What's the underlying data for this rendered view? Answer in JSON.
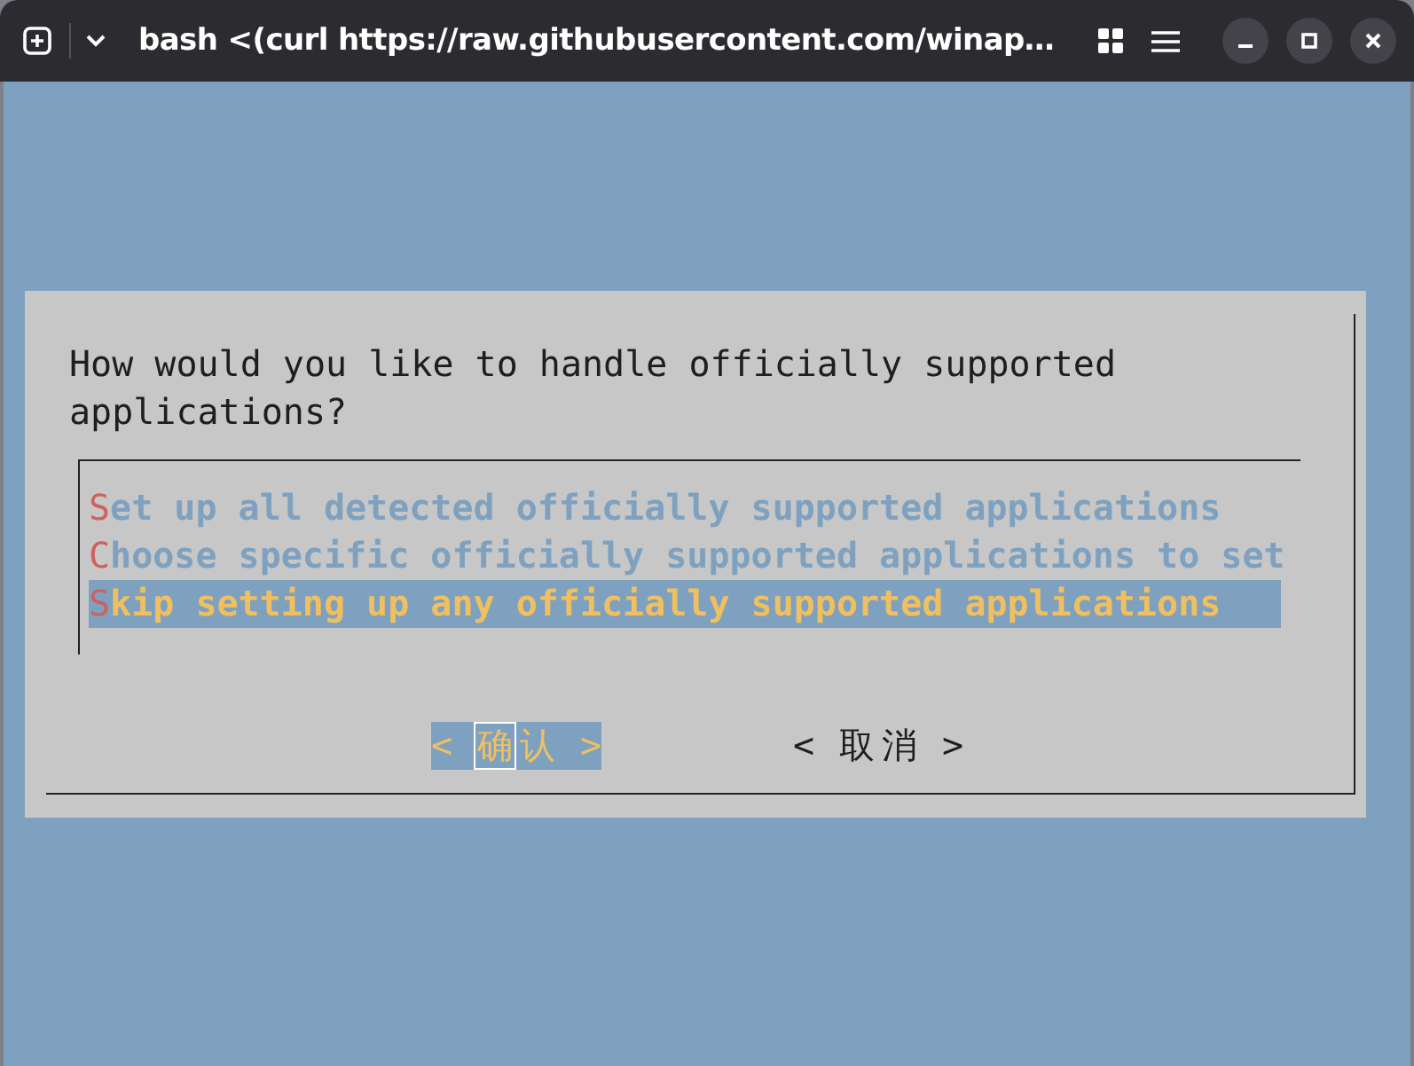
{
  "window": {
    "title": "bash <(curl https://raw.githubusercontent.com/winap…"
  },
  "dialog": {
    "prompt": "How would you like to handle officially supported applications?",
    "options": [
      {
        "label": "Set up all detected officially supported applications",
        "selected": false
      },
      {
        "label": "Choose specific officially supported applications to set",
        "selected": false
      },
      {
        "label": "Skip setting up any officially supported applications",
        "selected": true
      }
    ],
    "buttons": [
      {
        "label": "< 确认 >",
        "selected": true
      },
      {
        "label": "< 取消 >",
        "selected": false
      }
    ]
  }
}
